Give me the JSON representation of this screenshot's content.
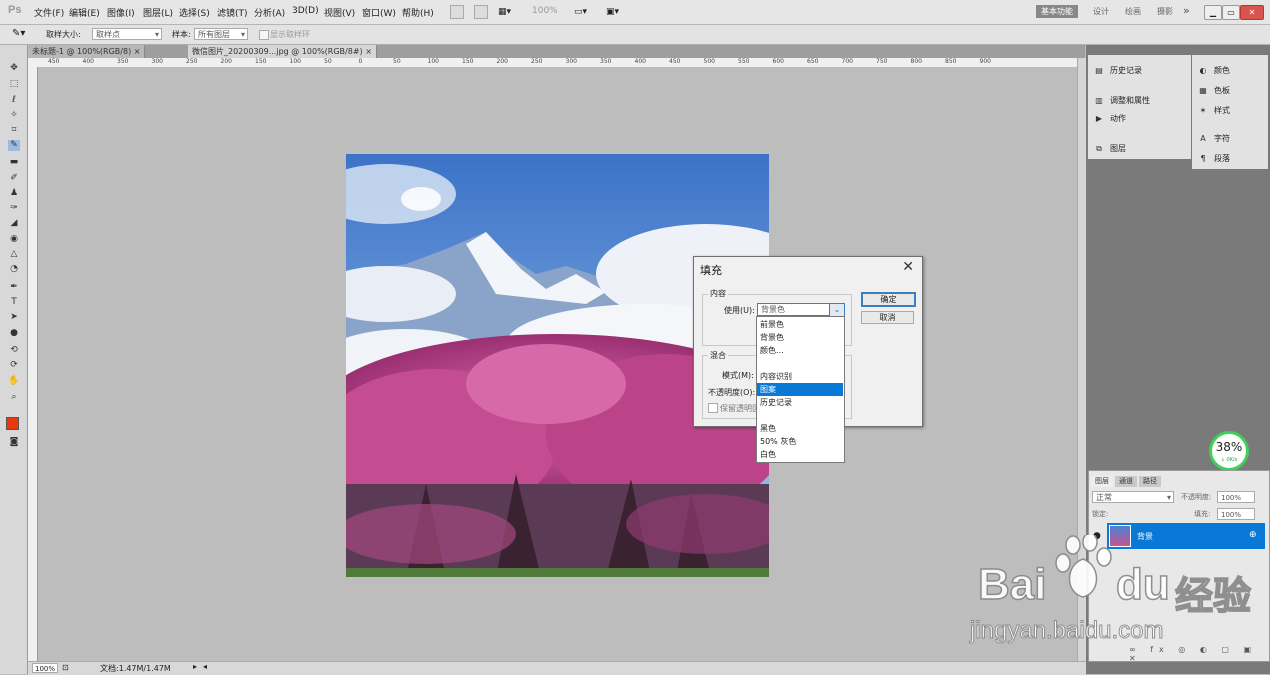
{
  "app": {
    "logo": "Ps",
    "menus": [
      "文件(F)",
      "编辑(E)",
      "图像(I)",
      "图层(L)",
      "选择(S)",
      "滤镜(T)",
      "分析(A)",
      "3D(D)",
      "视图(V)",
      "窗口(W)",
      "帮助(H)"
    ],
    "zoom_menu": "100%",
    "workspaces": [
      "基本功能",
      "设计",
      "绘画",
      "摄影"
    ],
    "more": "»"
  },
  "options_bar": {
    "sample_size_label": "取样大小:",
    "sample_size_value": "取样点",
    "sample_label": "样本:",
    "sample_value": "所有图层",
    "ring_label": "显示取样环"
  },
  "tabs": [
    {
      "label": "未标题-1 @ 100%(RGB/8)",
      "close": "×"
    },
    {
      "label": "微信图片_20200309...jpg @ 100%(RGB/8#)",
      "close": "×"
    }
  ],
  "ruler_ticks": [
    "450",
    "400",
    "350",
    "300",
    "250",
    "200",
    "150",
    "100",
    "50",
    "0",
    "50",
    "100",
    "150",
    "200",
    "250",
    "300",
    "350",
    "400",
    "450",
    "500",
    "550",
    "600",
    "650",
    "700",
    "750",
    "800",
    "850",
    "900"
  ],
  "dialog": {
    "title": "填充",
    "close": "✕",
    "contents_group": "内容",
    "use_label": "使用(U):",
    "use_value": "背景色",
    "blend_group": "混合",
    "mode_label": "模式(M):",
    "opacity_label": "不透明度(O):",
    "preserve_label": "保留透明区域(P)",
    "ok": "确定",
    "cancel": "取消",
    "options": [
      {
        "label": "前景色",
        "selected": false
      },
      {
        "label": "背景色",
        "selected": false
      },
      {
        "label": "颜色...",
        "selected": false
      },
      {
        "label": "",
        "selected": false
      },
      {
        "label": "内容识别",
        "selected": false
      },
      {
        "label": "图案",
        "selected": true
      },
      {
        "label": "历史记录",
        "selected": false
      },
      {
        "label": "",
        "selected": false
      },
      {
        "label": "黑色",
        "selected": false
      },
      {
        "label": "50% 灰色",
        "selected": false
      },
      {
        "label": "白色",
        "selected": false
      }
    ]
  },
  "panels": {
    "history": "历史记录",
    "adjustments": "调整和属性",
    "actions": "动作",
    "paths": "图层",
    "color": "颜色",
    "swatches": "色板",
    "styles": "样式",
    "character": "字符",
    "paragraph": "段落"
  },
  "layers": {
    "tabs": [
      "图层",
      "通道",
      "路径"
    ],
    "blend_mode": "正常",
    "opacity_label": "不透明度:",
    "opacity_value": "100%",
    "lock_label": "锁定:",
    "fill_label": "填充:",
    "fill_value": "100%",
    "layer_name": "背景"
  },
  "status": {
    "zoom": "100%",
    "doc": "文档:1.47M/1.47M"
  },
  "gauge": {
    "value": "38%",
    "sub": "↓ 0K/s",
    "ring_color": "#3fcf5a"
  },
  "watermark": {
    "brand": "Bai",
    "brand2": "du",
    "text": "经验",
    "url": "jingyan.baidu.com"
  },
  "colors": {
    "selection": "#0a78d7",
    "foreground": "#e8380d"
  }
}
